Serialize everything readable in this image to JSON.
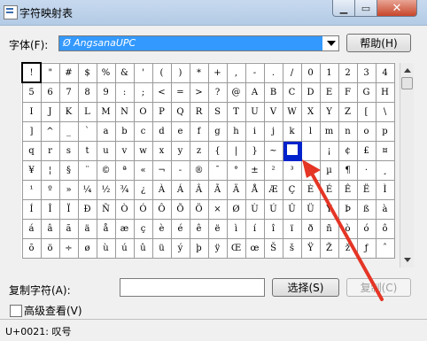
{
  "window": {
    "title": "字符映射表",
    "close_glyph": "✕"
  },
  "font": {
    "label": "字体(F):",
    "value": "Ø AngsanaUPC",
    "help_button": "帮助(H)"
  },
  "grid": {
    "rows": [
      [
        "!",
        "\"",
        "#",
        "$",
        "%",
        "&",
        "'",
        "(",
        ")",
        "*",
        "+",
        ",",
        "-",
        ".",
        "/",
        "0",
        "1",
        "2",
        "3",
        "4"
      ],
      [
        "5",
        "6",
        "7",
        "8",
        "9",
        ":",
        ";",
        "<",
        "=",
        ">",
        "?",
        "@",
        "A",
        "B",
        "C",
        "D",
        "E",
        "F",
        "G",
        "H"
      ],
      [
        "I",
        "J",
        "K",
        "L",
        "M",
        "N",
        "O",
        "P",
        "Q",
        "R",
        "S",
        "T",
        "U",
        "V",
        "W",
        "X",
        "Y",
        "Z",
        "[",
        "\\"
      ],
      [
        "]",
        "^",
        "_",
        "`",
        "a",
        "b",
        "c",
        "d",
        "e",
        "f",
        "g",
        "h",
        "i",
        "j",
        "k",
        "l",
        "m",
        "n",
        "o",
        "p"
      ],
      [
        "q",
        "r",
        "s",
        "t",
        "u",
        "v",
        "w",
        "x",
        "y",
        "z",
        "{",
        "|",
        "}",
        "~",
        "",
        "",
        "¡",
        "¢",
        "£",
        "¤"
      ],
      [
        "¥",
        "¦",
        "§",
        "¨",
        "©",
        "ª",
        "«",
        "¬",
        "-",
        "®",
        "¯",
        "°",
        "±",
        "²",
        "³",
        "´",
        "µ",
        "¶",
        "·",
        "¸"
      ],
      [
        "¹",
        "º",
        "»",
        "¼",
        "½",
        "¾",
        "¿",
        "À",
        "Á",
        "Â",
        "Ã",
        "Ä",
        "Å",
        "Æ",
        "Ç",
        "È",
        "É",
        "Ê",
        "Ë",
        "Ì"
      ],
      [
        "Í",
        "Î",
        "Ï",
        "Ð",
        "Ñ",
        "Ò",
        "Ó",
        "Ô",
        "Õ",
        "Ö",
        "×",
        "Ø",
        "Ù",
        "Ú",
        "Û",
        "Ü",
        "Ý",
        "Þ",
        "ß",
        "à"
      ],
      [
        "á",
        "â",
        "ã",
        "ä",
        "å",
        "æ",
        "ç",
        "è",
        "é",
        "ê",
        "ë",
        "ì",
        "í",
        "î",
        "ï",
        "ð",
        "ñ",
        "ò",
        "ó",
        "ô"
      ],
      [
        "õ",
        "ö",
        "÷",
        "ø",
        "ù",
        "ú",
        "û",
        "ü",
        "ý",
        "þ",
        "ÿ",
        "Œ",
        "œ",
        "Š",
        "š",
        "Ÿ",
        "Ž",
        "ž",
        "ƒ",
        "ˆ"
      ]
    ],
    "selected_row": 4,
    "selected_col": 14
  },
  "copy": {
    "label": "复制字符(A):",
    "value": "",
    "select_button": "选择(S)",
    "copy_button": "复制(C)"
  },
  "advanced": {
    "label": "高级查看(V)",
    "checked": false
  },
  "status": {
    "text": "U+0021: 叹号"
  },
  "colors": {
    "selection": "#0022cc",
    "annotation_arrow": "#e53525",
    "combo_highlight": "#3399ff"
  }
}
